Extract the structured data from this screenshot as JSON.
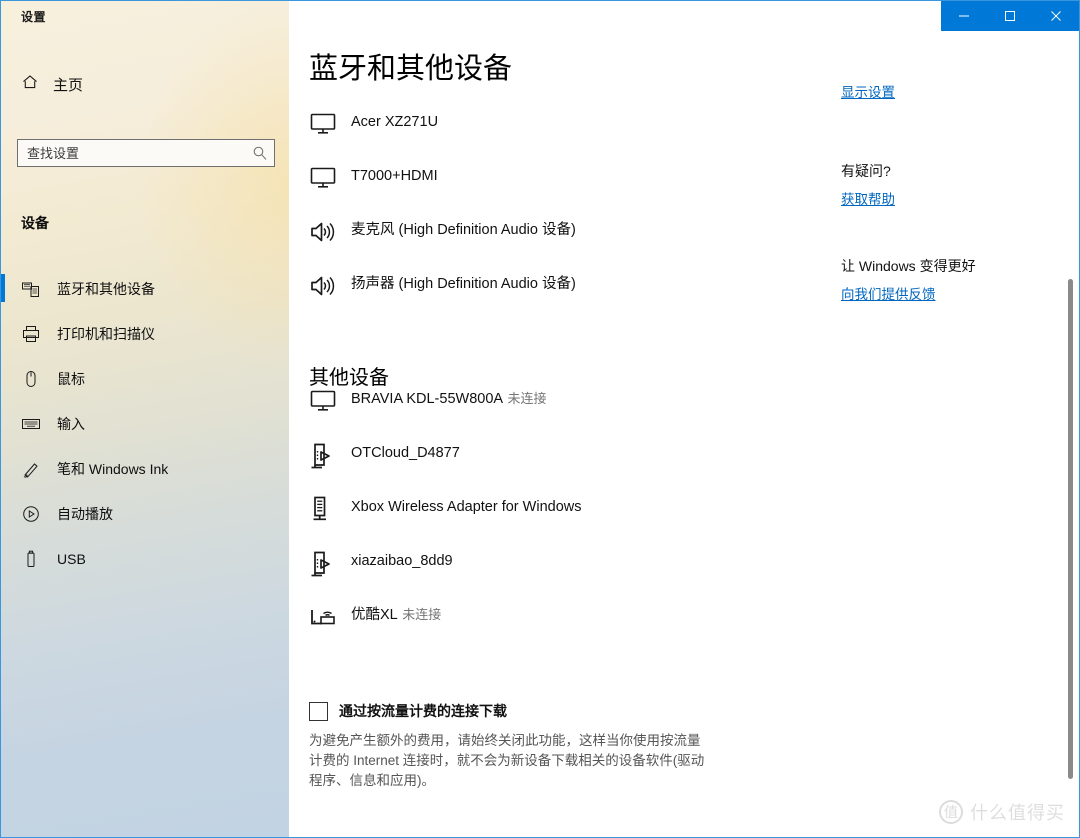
{
  "window": {
    "app_title": "设置",
    "accent_color": "#0078d7",
    "caption_buttons": [
      {
        "name": "minimize",
        "glyph": "minimize-icon"
      },
      {
        "name": "maximize",
        "glyph": "maximize-icon"
      },
      {
        "name": "close",
        "glyph": "close-icon"
      }
    ]
  },
  "sidebar": {
    "home_label": "主页",
    "home_icon": "home-icon",
    "search": {
      "placeholder": "查找设置",
      "value": "",
      "icon": "search-icon"
    },
    "section_header": "设备",
    "items": [
      {
        "label": "蓝牙和其他设备",
        "icon": "bluetooth-devices-icon",
        "selected": true
      },
      {
        "label": "打印机和扫描仪",
        "icon": "printer-icon",
        "selected": false
      },
      {
        "label": "鼠标",
        "icon": "mouse-icon",
        "selected": false
      },
      {
        "label": "输入",
        "icon": "keyboard-icon",
        "selected": false
      },
      {
        "label": "笔和 Windows Ink",
        "icon": "pen-icon",
        "selected": false
      },
      {
        "label": "自动播放",
        "icon": "autoplay-icon",
        "selected": false
      },
      {
        "label": "USB",
        "icon": "usb-icon",
        "selected": false
      }
    ]
  },
  "main": {
    "page_title": "蓝牙和其他设备",
    "connected_devices": [
      {
        "name": "Acer XZ271U",
        "status": "",
        "icon": "monitor-icon"
      },
      {
        "name": "T7000+HDMI",
        "status": "",
        "icon": "monitor-icon"
      },
      {
        "name": "麦克风 (High Definition Audio 设备)",
        "status": "",
        "icon": "speaker-icon"
      },
      {
        "name": "扬声器 (High Definition Audio 设备)",
        "status": "",
        "icon": "speaker-icon"
      }
    ],
    "other_devices_header": "其他设备",
    "other_devices": [
      {
        "name": "BRAVIA KDL-55W800A",
        "status": "未连接",
        "icon": "monitor-icon"
      },
      {
        "name": "OTCloud_D4877",
        "status": "",
        "icon": "media-device-icon"
      },
      {
        "name": "Xbox Wireless Adapter for Windows",
        "status": "",
        "icon": "network-device-icon"
      },
      {
        "name": "xiazaibao_8dd9",
        "status": "",
        "icon": "media-device-icon"
      },
      {
        "name": "优酷XL",
        "status": "未连接",
        "icon": "wireless-display-icon"
      }
    ],
    "metered": {
      "checkbox_label": "通过按流量计费的连接下载",
      "checked": false,
      "description": "为避免产生额外的费用，请始终关闭此功能，这样当你使用按流量计费的 Internet 连接时，就不会为新设备下载相关的设备软件(驱动程序、信息和应用)。"
    }
  },
  "right_panel": {
    "display_settings_link": "显示设置",
    "help_header": "有疑问?",
    "help_link": "获取帮助",
    "feedback_header": "让 Windows 变得更好",
    "feedback_link": "向我们提供反馈",
    "link_color": "#0067c0"
  },
  "watermark": {
    "badge": "值",
    "text": "什么值得买"
  }
}
